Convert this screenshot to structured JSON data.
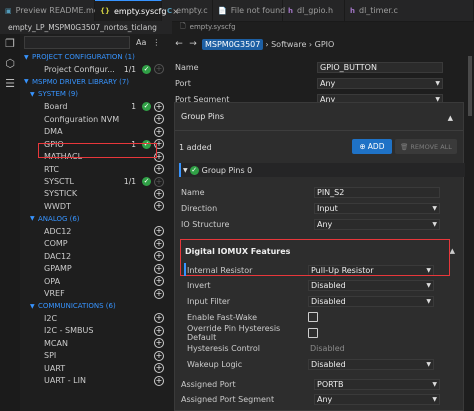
{
  "tabs": [
    {
      "icon": "preview-icon",
      "glyph": "▣",
      "label": "Preview README.md",
      "active": false
    },
    {
      "icon": "syscfg-file-icon",
      "glyph": "{}",
      "label": "empty.syscfg",
      "active": true
    },
    {
      "icon": "c-file-icon",
      "glyph": "C",
      "label": "empty.c",
      "active": false
    },
    {
      "icon": "file-icon",
      "glyph": "📄",
      "label": "File not found",
      "active": false
    },
    {
      "icon": "h-file-icon",
      "glyph": "h",
      "label": "dl_gpio.h",
      "active": false
    },
    {
      "icon": "h-file-icon",
      "glyph": "h",
      "label": "dl_timer.c",
      "active": false
    }
  ],
  "subtab_left": "empty_LP_MSPM0G3507_nortos_ticlang",
  "breadcrumb_file": "empty.syscfg",
  "sidebar": {
    "filter_placeholder": "",
    "case_label": "Aa",
    "rows": [
      {
        "type": "cat",
        "label": "PROJECT CONFIGURATION (1)"
      },
      {
        "type": "item",
        "label": "Project Configur...",
        "count": "1/1",
        "check": true,
        "plus": "dim"
      },
      {
        "type": "cat",
        "label": "MSPM0 DRIVER LIBRARY (7)"
      },
      {
        "type": "subcat",
        "label": "SYSTEM (9)"
      },
      {
        "type": "item",
        "label": "Board",
        "count": "1",
        "check": true,
        "plus": "on"
      },
      {
        "type": "item",
        "label": "Configuration NVM",
        "count": "",
        "check": false,
        "plus": "on"
      },
      {
        "type": "item",
        "label": "DMA",
        "count": "",
        "check": false,
        "plus": "on"
      },
      {
        "type": "item",
        "label": "GPIO",
        "count": "1",
        "check": true,
        "plus": "on"
      },
      {
        "type": "item",
        "label": "MATHACL",
        "count": "",
        "check": false,
        "plus": "on"
      },
      {
        "type": "item",
        "label": "RTC",
        "count": "",
        "check": false,
        "plus": "on"
      },
      {
        "type": "item",
        "label": "SYSCTL",
        "count": "1/1",
        "check": true,
        "plus": "dim"
      },
      {
        "type": "item",
        "label": "SYSTICK",
        "count": "",
        "check": false,
        "plus": "on"
      },
      {
        "type": "item",
        "label": "WWDT",
        "count": "",
        "check": false,
        "plus": "on"
      },
      {
        "type": "subcat",
        "label": "ANALOG (6)"
      },
      {
        "type": "item",
        "label": "ADC12",
        "count": "",
        "check": false,
        "plus": "on"
      },
      {
        "type": "item",
        "label": "COMP",
        "count": "",
        "check": false,
        "plus": "on"
      },
      {
        "type": "item",
        "label": "DAC12",
        "count": "",
        "check": false,
        "plus": "on"
      },
      {
        "type": "item",
        "label": "GPAMP",
        "count": "",
        "check": false,
        "plus": "on"
      },
      {
        "type": "item",
        "label": "OPA",
        "count": "",
        "check": false,
        "plus": "on"
      },
      {
        "type": "item",
        "label": "VREF",
        "count": "",
        "check": false,
        "plus": "on"
      },
      {
        "type": "subcat",
        "label": "COMMUNICATIONS (6)"
      },
      {
        "type": "item",
        "label": "I2C",
        "count": "",
        "check": false,
        "plus": "on"
      },
      {
        "type": "item",
        "label": "I2C - SMBUS",
        "count": "",
        "check": false,
        "plus": "on"
      },
      {
        "type": "item",
        "label": "MCAN",
        "count": "",
        "check": false,
        "plus": "on"
      },
      {
        "type": "item",
        "label": "SPI",
        "count": "",
        "check": false,
        "plus": "on"
      },
      {
        "type": "item",
        "label": "UART",
        "count": "",
        "check": false,
        "plus": "on"
      },
      {
        "type": "item",
        "label": "UART - LIN",
        "count": "",
        "check": false,
        "plus": "on"
      }
    ]
  },
  "nav": {
    "device": "MSPM0G3507",
    "path": "› Software › GPIO"
  },
  "top_fields": [
    {
      "label": "Name",
      "value": "GPIO_BUTTON",
      "kind": "text"
    },
    {
      "label": "Port",
      "value": "Any",
      "kind": "select"
    },
    {
      "label": "Port Segment",
      "value": "Any",
      "kind": "select"
    }
  ],
  "group": {
    "title": "Group Pins",
    "added": "1 added",
    "add_label": "ADD",
    "remove_label": "REMOVE ALL",
    "instance": "Group Pins 0",
    "fields": [
      {
        "label": "Name",
        "value": "PIN_S2",
        "kind": "text"
      },
      {
        "label": "Direction",
        "value": "Input",
        "kind": "select"
      },
      {
        "label": "IO Structure",
        "value": "Any",
        "kind": "select"
      }
    ],
    "iomux_title": "Digital IOMUX Features",
    "iomux_fields": [
      {
        "label": "Internal Resistor",
        "value": "Pull-Up Resistor",
        "kind": "select"
      },
      {
        "label": "Invert",
        "value": "Disabled",
        "kind": "select"
      },
      {
        "label": "Input Filter",
        "value": "Disabled",
        "kind": "select"
      },
      {
        "label": "Enable Fast-Wake",
        "value": "",
        "kind": "checkbox"
      },
      {
        "label": "Override Pin Hysteresis Default",
        "value": "",
        "kind": "checkbox"
      },
      {
        "label": "Hysteresis Control",
        "value": "Disabled",
        "kind": "disabled"
      },
      {
        "label": "Wakeup Logic",
        "value": "Disabled",
        "kind": "select"
      }
    ],
    "port_fields": [
      {
        "label": "Assigned Port",
        "value": "PORTB",
        "kind": "select"
      },
      {
        "label": "Assigned Port Segment",
        "value": "Any",
        "kind": "select"
      }
    ]
  }
}
